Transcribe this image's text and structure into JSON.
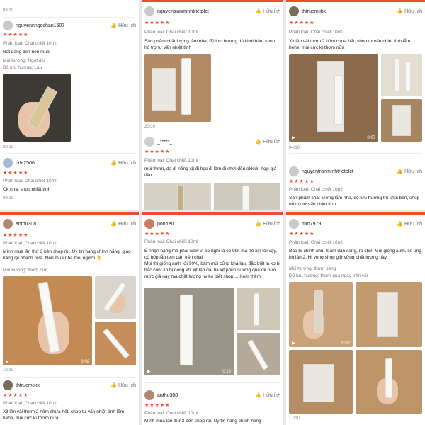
{
  "common": {
    "helpful": "Hữu ích",
    "category": "Phân loại: Chai chiết 10ml",
    "stars": "★★★★★",
    "video_icon": "▶",
    "accent": "#ee4d2d"
  },
  "col1": {
    "top_date": "03/10",
    "r1": {
      "user": "nguyennngochan1507",
      "scent": "Mùi hương: Ngọt dịu",
      "duration": "Độ lưu hương: Lâu",
      "text": "Rất đáng tiền nên mua",
      "date": "20/10"
    },
    "r2": {
      "user": "ntle2506",
      "text": "Ok nha, shop nhiệt tình",
      "date": "09/10"
    },
    "r3": {
      "user": "anthu308",
      "text": "Mình mua lần thứ 3 bên shop rồi. Uy tín hàng chính hãng, giao hàng lại nhanh nữa. Nên mua nha mọi người 👌",
      "scent": "Mùi hương: thơm cực",
      "video_time": "0:02",
      "date": "19/10"
    },
    "r4": {
      "user": "thtruemlikk",
      "text": "Xịt lên vải thơm 2 hôm chưa hết, shop tư vấn nhiệt tình lắm hehe, mùi cực kì thơm nữa"
    }
  },
  "col2": {
    "r1": {
      "user": "nguyentranminhtrietplct",
      "text": "Sản phẩm chất lượng lắm nha, độ lưu hương thì khỏi bàn, shop hỗ trợ tư vấn nhiệt tình",
      "date": "20/10"
    },
    "r2": {
      "user": "_*****_",
      "text": "mùi thơm, da dì nắng xịt đi học đi làm đi chơi đều okkkk, hợp giá tiền"
    },
    "r3": {
      "user": "ponheu",
      "text": "Ế nhận hàng mà phải wow vì ko nghĩ là có 99k mà nó xịn tới vậy, có hộp lẫn tem dán trên chai",
      "text2": "Mùi thì giống auth tới 90%, bám mùi cũng khá lâu, đặc biệt là ko bị hắc cồn, ko bị nồng khi xịt lên da, tia xịt phun sương quá ok. Với mức giá này mà chất lượng nv ko biết shop ... Xem thêm",
      "video_time": "0:16"
    },
    "r4": {
      "user": "anthu308",
      "text": "Mình mua lần thứ 3 bên shop rồi. Uy tín hàng chính hãng"
    }
  },
  "col3": {
    "r1": {
      "user": "thtruemlikk",
      "text": "Xịt lên vải thơm 2 hôm chưa hết, shop tư vấn nhiệt tình lắm hehe, mùi cực kì thơm nữa",
      "video_time": "0:07",
      "date": "04/10"
    },
    "r2": {
      "user": "nguyentranminhtrietplct",
      "text": "Sản phẩm chất lượng lắm nha, độ lưu hương thì khỏi bàn, shop hỗ trợ tư vấn nhiệt tình"
    },
    "r3": {
      "user": "mm7979",
      "text": "Bao bì chỉnh chu, team dân sang, rõ chữ. Mùi giống auth, sẽ ủng hộ lần 2. Hi vọng shop giữ vững chất lượng này",
      "scent": "Mùi hương: thơm sang",
      "duration": "Độ lưu hương: thơm qua ngày trên vải",
      "video_time": "0:02",
      "date": "17/10"
    }
  }
}
